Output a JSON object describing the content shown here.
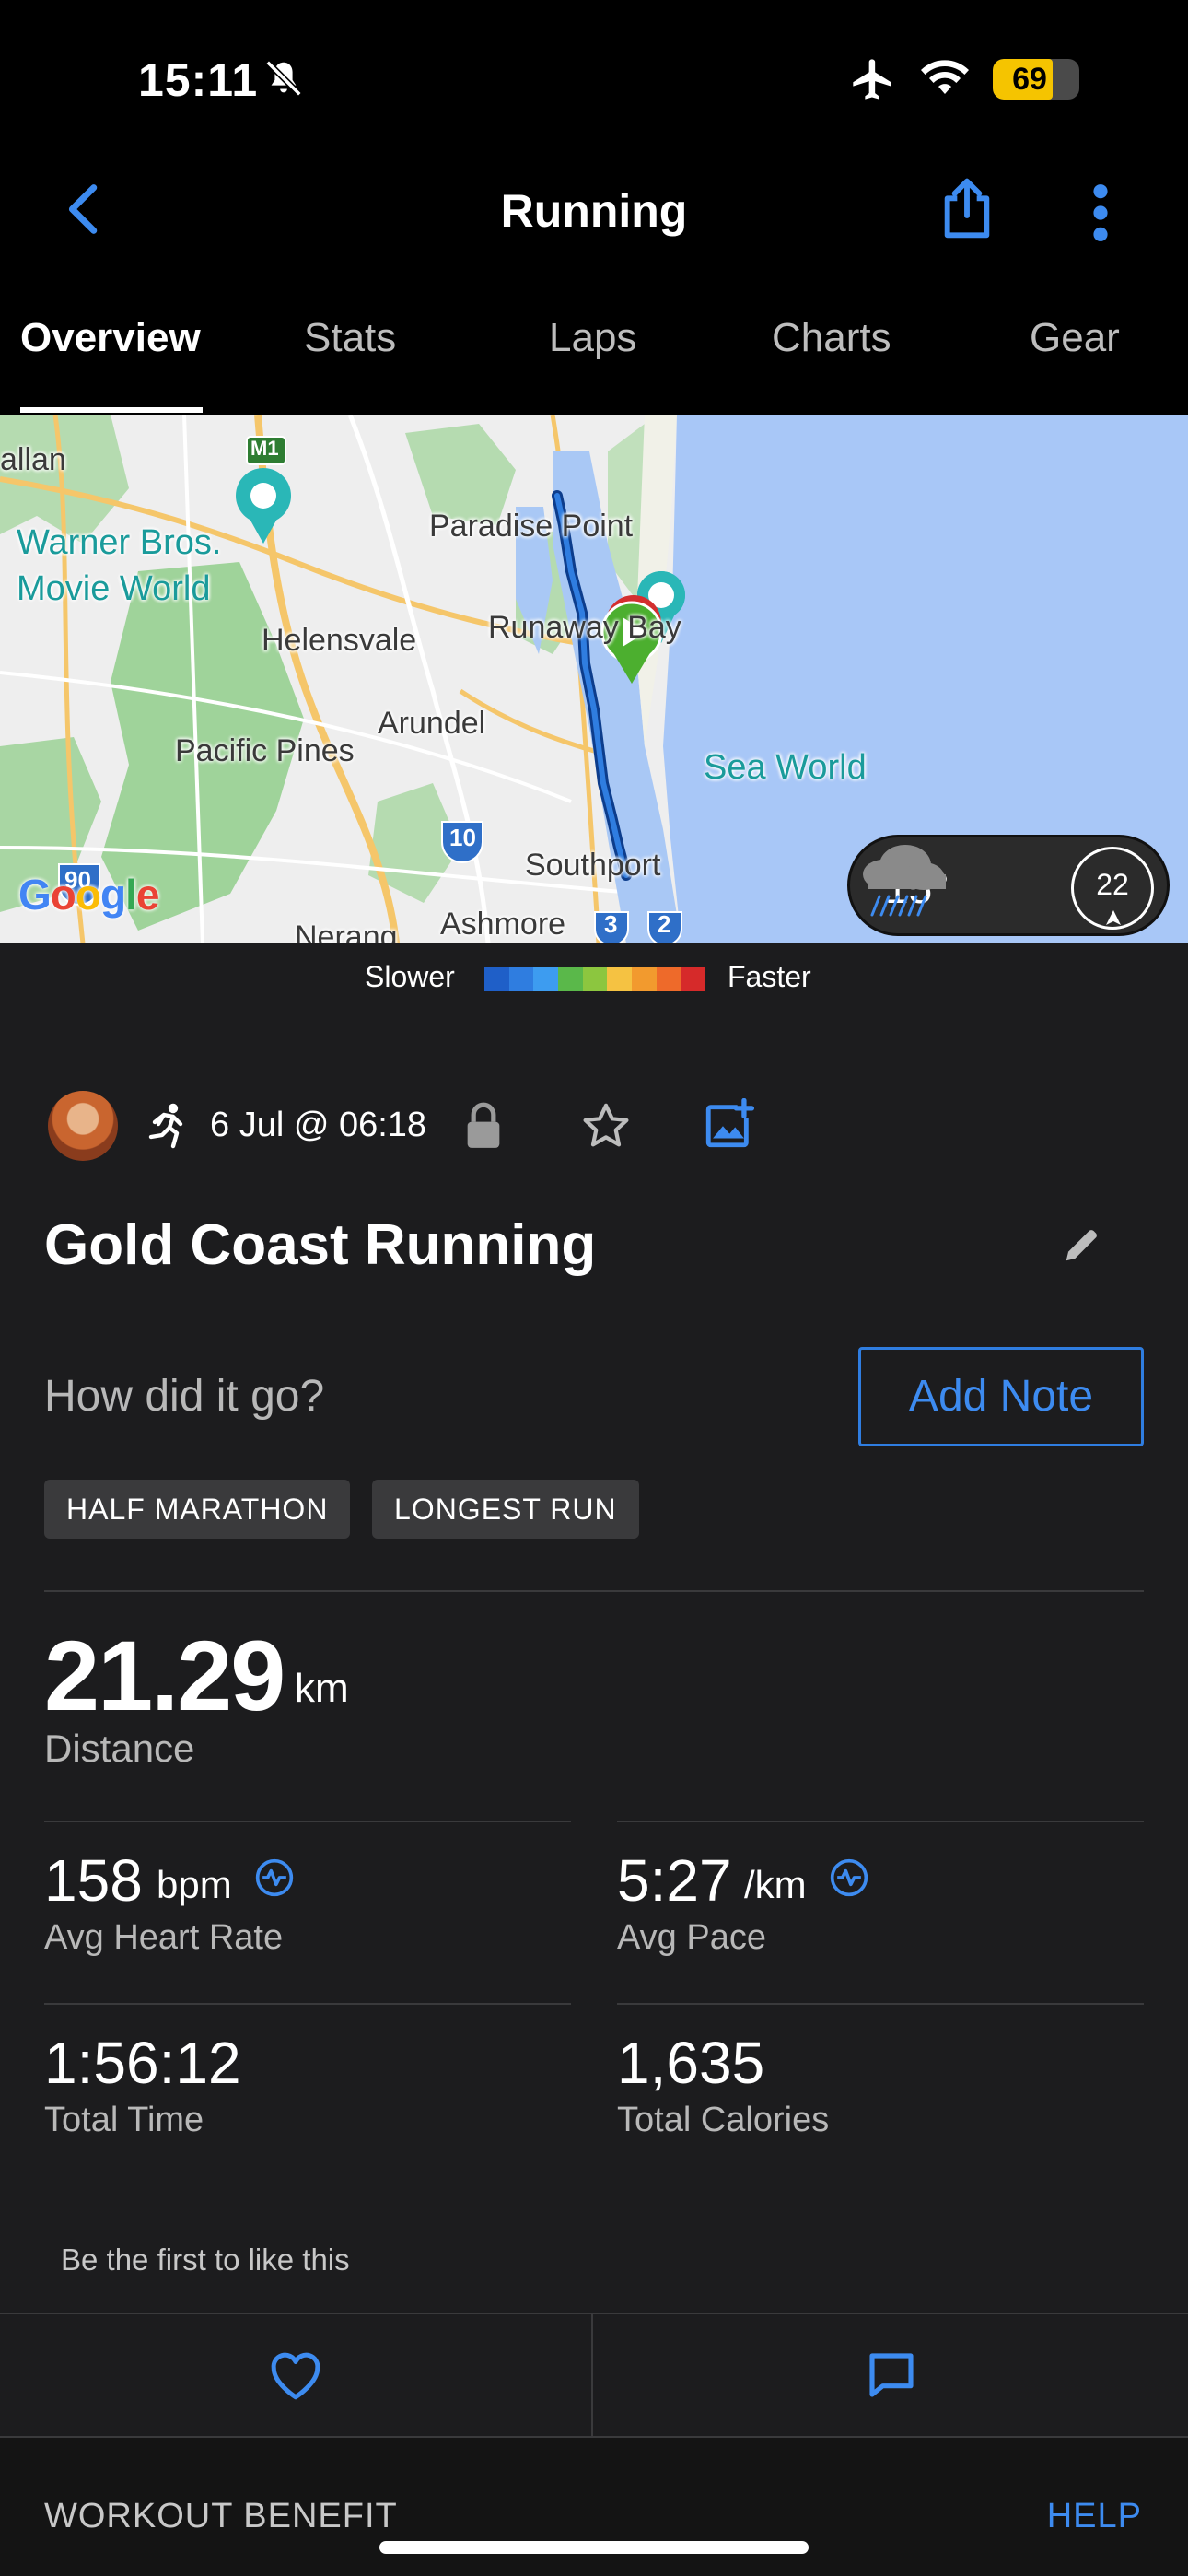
{
  "status_bar": {
    "time": "15:11",
    "battery": "69",
    "battery_level": 0.69
  },
  "nav": {
    "title": "Running"
  },
  "tabs": [
    {
      "label": "Overview",
      "active": true
    },
    {
      "label": "Stats"
    },
    {
      "label": "Laps"
    },
    {
      "label": "Charts"
    },
    {
      "label": "Gear"
    }
  ],
  "map": {
    "labels": {
      "allan": "allan",
      "warner1": "Warner Bros.",
      "warner2": "Movie World",
      "helensvale": "Helensvale",
      "paradise": "Paradise Point",
      "runaway": "Runaway Bay",
      "arundel": "Arundel",
      "pacific": "Pacific Pines",
      "seaworld": "Sea World",
      "southport": "Southport",
      "ashmore": "Ashmore",
      "nerang": "Nerang",
      "m1": "M1",
      "r90": "90",
      "r10": "10",
      "r3": "3",
      "r2": "2"
    },
    "attribution": "Google",
    "weather": {
      "temp": "15°",
      "wind": "22"
    }
  },
  "pace_legend": {
    "slower": "Slower",
    "faster": "Faster",
    "colors": [
      "#1f5fc8",
      "#2f7de0",
      "#3d9cf0",
      "#5ab84a",
      "#8cc63f",
      "#f5c242",
      "#f29a2e",
      "#ee6a2a",
      "#d62a2a"
    ]
  },
  "activity": {
    "date": "6 Jul @ 06:18",
    "title": "Gold Coast Running",
    "note_prompt": "How did it go?",
    "add_note_label": "Add Note",
    "badges": [
      "HALF MARATHON",
      "LONGEST RUN"
    ]
  },
  "stats": {
    "distance": {
      "value": "21.29",
      "unit": "km",
      "label": "Distance"
    },
    "avg_hr": {
      "value": "158",
      "unit": "bpm",
      "label": "Avg Heart Rate"
    },
    "avg_pace": {
      "value": "5:27",
      "unit": "/km",
      "label": "Avg Pace"
    },
    "total_time": {
      "value": "1:56:12",
      "label": "Total Time"
    },
    "calories": {
      "value": "1,635",
      "label": "Total Calories"
    }
  },
  "social": {
    "likes_text": "Be the first to like this"
  },
  "section": {
    "title": "WORKOUT BENEFIT",
    "help": "HELP"
  }
}
